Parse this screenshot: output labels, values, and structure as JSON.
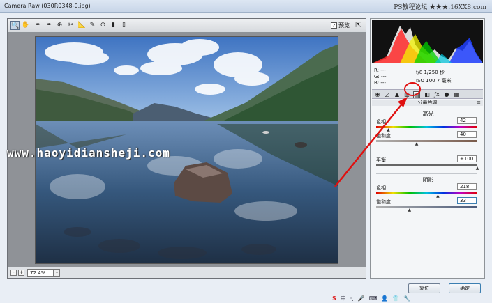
{
  "window": {
    "title": "Camera Raw (030R0348-0.jpg)",
    "forum_watermark": "PS教程论坛 ★★★.16XX8.com"
  },
  "toolbar": {
    "tools": [
      {
        "name": "zoom-tool-icon",
        "glyph": "🔍"
      },
      {
        "name": "hand-tool-icon",
        "glyph": "✋"
      },
      {
        "name": "white-balance-tool-icon",
        "glyph": "✒"
      },
      {
        "name": "color-sampler-icon",
        "glyph": "✒"
      },
      {
        "name": "target-adjust-icon",
        "glyph": "⊕"
      },
      {
        "name": "crop-tool-icon",
        "glyph": "✂"
      },
      {
        "name": "straighten-tool-icon",
        "glyph": "📐"
      },
      {
        "name": "spot-removal-icon",
        "glyph": "✎"
      },
      {
        "name": "red-eye-icon",
        "glyph": "⊙"
      },
      {
        "name": "adjustment-brush-icon",
        "glyph": "▮"
      },
      {
        "name": "graduated-filter-icon",
        "glyph": "▯"
      }
    ],
    "preview_label": "预览",
    "preview_checked": "✓"
  },
  "zoom": {
    "minus": "-",
    "plus": "+",
    "value": "72.4%",
    "dropdown": "▾"
  },
  "site_watermark": "www.haoyidiansheji.com",
  "exif": {
    "r": "R:  ---",
    "g": "G:  ---",
    "b": "B:  ---",
    "aperture_shutter": "f/8   1/250 秒",
    "iso_focal": "ISO 100   7 毫米"
  },
  "section": {
    "title": "分离色调",
    "menu": "≡"
  },
  "highlights": {
    "title": "高光",
    "hue_label": "色相",
    "hue_value": "42",
    "hue_fraction": 0.12,
    "sat_label": "饱和度",
    "sat_value": "40",
    "sat_fraction": 0.4
  },
  "balance": {
    "label": "平衡",
    "value": "+100",
    "fraction": 1.0
  },
  "shadows": {
    "title": "阴影",
    "hue_label": "色相",
    "hue_value": "218",
    "hue_fraction": 0.61,
    "sat_label": "饱和度",
    "sat_value": "33",
    "sat_fraction": 0.33
  },
  "buttons": {
    "reset": "复位",
    "ok": "确定"
  },
  "tray": {
    "ime_logo": "S",
    "ime_mode": "中",
    "items": [
      "·,",
      "🎤",
      "⌨",
      "👤",
      "👕",
      "🔧"
    ]
  },
  "colors": {
    "annotation": "#e01010",
    "sky": "#4f86c9",
    "water": "#3b5f86"
  }
}
